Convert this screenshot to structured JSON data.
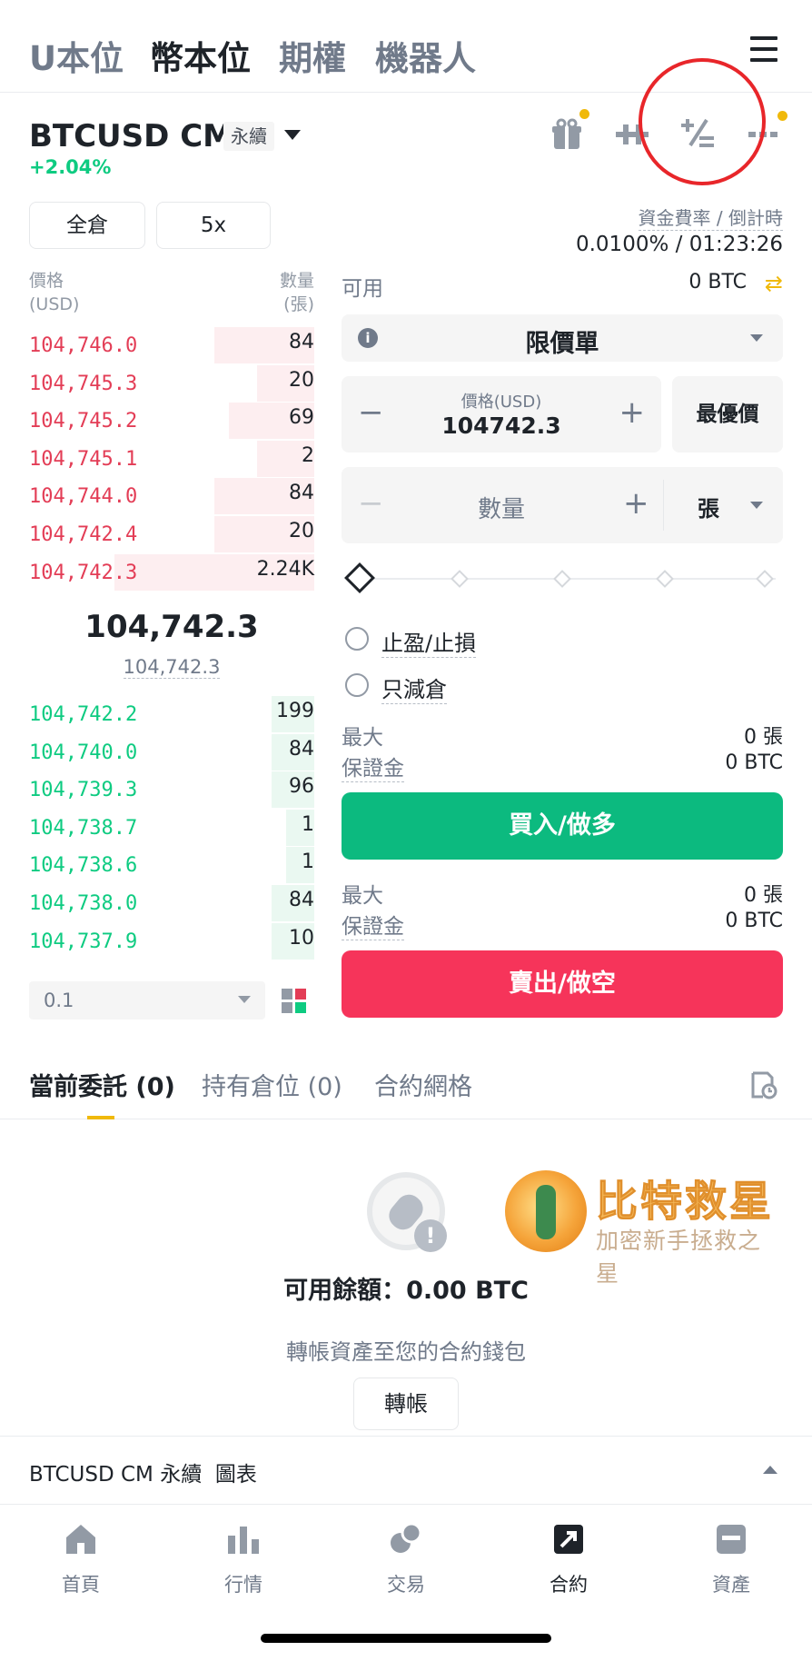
{
  "top_tabs": [
    "U本位",
    "幣本位",
    "期權",
    "機器人"
  ],
  "pair": {
    "name": "BTCUSD CM",
    "badge": "永續",
    "change": "+2.04%"
  },
  "header_icons": [
    "gift-icon",
    "plus-minus-icon",
    "percent-calc-icon",
    "more-icon"
  ],
  "margin_mode": "全倉",
  "leverage": "5x",
  "funding": {
    "label": "資金費率 / 倒計時",
    "value": "0.0100% / 01:23:26"
  },
  "orderbook": {
    "price_header": [
      "價格",
      "(USD)"
    ],
    "qty_header": [
      "數量",
      "(張)"
    ],
    "asks": [
      {
        "price": "104,746.0",
        "qty": "84",
        "depth": 0.35
      },
      {
        "price": "104,745.3",
        "qty": "20",
        "depth": 0.2
      },
      {
        "price": "104,745.2",
        "qty": "69",
        "depth": 0.3
      },
      {
        "price": "104,745.1",
        "qty": "2",
        "depth": 0.2
      },
      {
        "price": "104,744.0",
        "qty": "84",
        "depth": 0.35
      },
      {
        "price": "104,742.4",
        "qty": "20",
        "depth": 0.35
      },
      {
        "price": "104,742.3",
        "qty": "2.24K",
        "depth": 0.7
      }
    ],
    "mid_price": "104,742.3",
    "mark_price": "104,742.3",
    "bids": [
      {
        "price": "104,742.2",
        "qty": "199",
        "depth": 0.15
      },
      {
        "price": "104,740.0",
        "qty": "84",
        "depth": 0.15
      },
      {
        "price": "104,739.3",
        "qty": "96",
        "depth": 0.15
      },
      {
        "price": "104,738.7",
        "qty": "1",
        "depth": 0.1
      },
      {
        "price": "104,738.6",
        "qty": "1",
        "depth": 0.1
      },
      {
        "price": "104,738.0",
        "qty": "84",
        "depth": 0.15
      },
      {
        "price": "104,737.9",
        "qty": "10",
        "depth": 0.15
      }
    ],
    "depth_step": "0.1"
  },
  "trade_form": {
    "available_label": "可用",
    "available_value": "0 BTC",
    "order_type": "限價單",
    "price_label": "價格(USD)",
    "price_value": "104742.3",
    "best_price": "最優價",
    "qty_label": "數量",
    "qty_unit": "張",
    "tp_sl": "止盈/止損",
    "reduce_only": "只減倉",
    "buy": {
      "max_label": "最大",
      "max_value": "0 張",
      "margin_label": "保證金",
      "margin_value": "0 BTC",
      "button": "買入/做多"
    },
    "sell": {
      "max_label": "最大",
      "max_value": "0 張",
      "margin_label": "保證金",
      "margin_value": "0 BTC",
      "button": "賣出/做空"
    }
  },
  "bottom_tabs": [
    "當前委託 (0)",
    "持有倉位 (0)",
    "合約網格"
  ],
  "empty_state": {
    "balance": "可用餘額：0.00 BTC",
    "hint": "轉帳資產至您的合約錢包",
    "button": "轉帳"
  },
  "watermark": {
    "title": "比特救星",
    "subtitle": "加密新手拯救之星"
  },
  "chart_bar": "BTCUSD CM 永續  圖表",
  "nav": [
    {
      "label": "首頁",
      "icon": "home-icon"
    },
    {
      "label": "行情",
      "icon": "markets-icon"
    },
    {
      "label": "交易",
      "icon": "trade-icon"
    },
    {
      "label": "合約",
      "icon": "futures-icon"
    },
    {
      "label": "資產",
      "icon": "wallet-icon"
    }
  ],
  "colors": {
    "ask": "#e33d56",
    "bid": "#0ecb81",
    "accent": "#f0b90b",
    "buy": "#0cba7f",
    "sell": "#f6345a",
    "annotation": "#e8262a"
  }
}
